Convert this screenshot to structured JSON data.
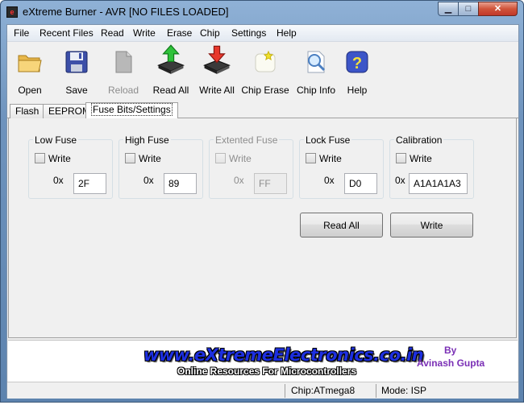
{
  "window": {
    "title": "eXtreme Burner - AVR [NO FILES LOADED]",
    "app_icon_glyph": "e",
    "min_glyph": "▁",
    "max_glyph": "□",
    "close_glyph": "✕"
  },
  "menu": {
    "items": [
      {
        "label": "File"
      },
      {
        "label": "Recent Files"
      },
      {
        "label": "Read"
      },
      {
        "label": "Write"
      },
      {
        "label": "Erase"
      },
      {
        "label": "Chip"
      },
      {
        "label": "Settings"
      },
      {
        "label": "Help"
      }
    ]
  },
  "toolbar": {
    "open": {
      "label": "Open",
      "icon": "folder-icon"
    },
    "save": {
      "label": "Save",
      "icon": "floppy-icon"
    },
    "reload": {
      "label": "Reload",
      "icon": "document-icon",
      "enabled": false
    },
    "read_all": {
      "label": "Read All",
      "icon": "chip-read-icon"
    },
    "write_all": {
      "label": "Write All",
      "icon": "chip-write-icon"
    },
    "chip_erase": {
      "label": "Chip Erase",
      "icon": "eraser-icon"
    },
    "chip_info": {
      "label": "Chip Info",
      "icon": "magnifier-icon"
    },
    "help": {
      "label": "Help",
      "icon": "help-icon",
      "glyph": "?"
    }
  },
  "tabs": [
    {
      "label": "Flash",
      "active": false
    },
    {
      "label": "EEPROM",
      "active": false
    },
    {
      "label": "Fuse Bits/Settings",
      "active": true
    }
  ],
  "fuses": {
    "prefix": "0x",
    "write_label": "Write",
    "low": {
      "title": "Low Fuse",
      "value": "2F",
      "write_checked": false,
      "enabled": true
    },
    "high": {
      "title": "High Fuse",
      "value": "89",
      "write_checked": false,
      "enabled": true
    },
    "extended": {
      "title": "Extented Fuse",
      "value": "FF",
      "write_checked": false,
      "enabled": false
    },
    "lock": {
      "title": "Lock Fuse",
      "value": "D0",
      "write_checked": false,
      "enabled": true
    },
    "calibration": {
      "title": "Calibration",
      "value": "A1A1A1A3",
      "write_checked": false,
      "enabled": true
    }
  },
  "actions": {
    "read_all_label": "Read All",
    "write_label": "Write"
  },
  "banner": {
    "url": "www.eXtremeElectronics.co.in",
    "tagline": "Online Resources For Microcontrollers",
    "by": "By",
    "author": "Avinash Gupta"
  },
  "status": {
    "chip": "Chip:ATmega8",
    "mode": "Mode: ISP"
  },
  "colors": {
    "accent_blue": "#1d2fe0",
    "author_purple": "#7a2fb5",
    "title_bar": "#6e93bd"
  }
}
